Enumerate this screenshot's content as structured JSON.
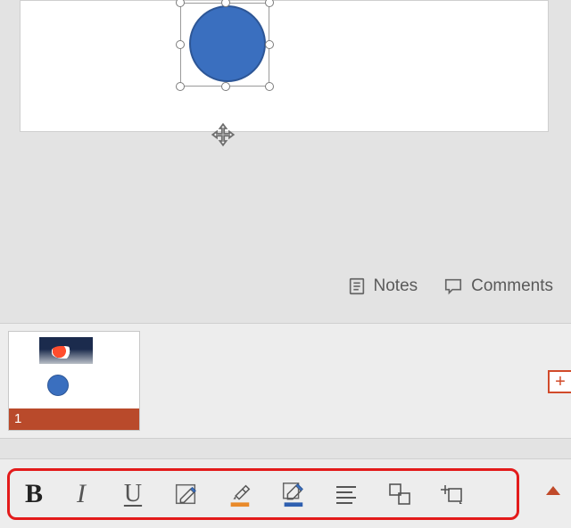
{
  "editor": {
    "selected_shape": "circle",
    "shape_fill": "#3a6fbf",
    "shape_border": "#2d5696"
  },
  "status": {
    "notes_label": "Notes",
    "comments_label": "Comments"
  },
  "thumbnails": {
    "slides": [
      {
        "number": "1"
      }
    ],
    "new_slide_glyph": "+"
  },
  "toolbar": {
    "bold_label": "B",
    "italic_label": "I",
    "underline_label": "U",
    "icons": {
      "font_color": "font-color-icon",
      "highlight": "highlight-color-icon",
      "shape_outline": "shape-outline-color-icon",
      "paragraph": "paragraph-icon",
      "arrange": "arrange-icon",
      "insert": "insert-icon"
    },
    "highlight_color": "#e98a2a",
    "outline_color": "#2e5fb0"
  }
}
